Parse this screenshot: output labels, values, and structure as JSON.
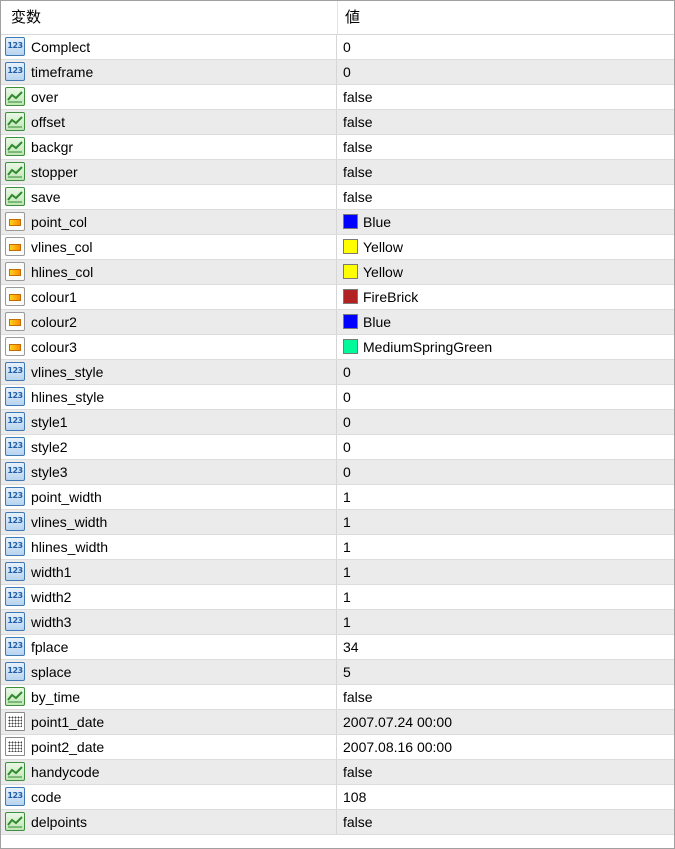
{
  "header": {
    "name_col": "変数",
    "value_col": "値"
  },
  "rows": [
    {
      "type": "int",
      "name": "Complect",
      "value": "0"
    },
    {
      "type": "int",
      "name": "timeframe",
      "value": "0"
    },
    {
      "type": "bool",
      "name": "over",
      "value": "false"
    },
    {
      "type": "bool",
      "name": "offset",
      "value": "false"
    },
    {
      "type": "bool",
      "name": "backgr",
      "value": "false"
    },
    {
      "type": "bool",
      "name": "stopper",
      "value": "false"
    },
    {
      "type": "bool",
      "name": "save",
      "value": "false"
    },
    {
      "type": "color",
      "name": "point_col",
      "value": "Blue",
      "swatch": "#0000ff"
    },
    {
      "type": "color",
      "name": "vlines_col",
      "value": "Yellow",
      "swatch": "#ffff00"
    },
    {
      "type": "color",
      "name": "hlines_col",
      "value": "Yellow",
      "swatch": "#ffff00"
    },
    {
      "type": "color",
      "name": "colour1",
      "value": "FireBrick",
      "swatch": "#b22222"
    },
    {
      "type": "color",
      "name": "colour2",
      "value": "Blue",
      "swatch": "#0000ff"
    },
    {
      "type": "color",
      "name": "colour3",
      "value": "MediumSpringGreen",
      "swatch": "#00fa9a"
    },
    {
      "type": "int",
      "name": "vlines_style",
      "value": "0"
    },
    {
      "type": "int",
      "name": "hlines_style",
      "value": "0"
    },
    {
      "type": "int",
      "name": "style1",
      "value": "0"
    },
    {
      "type": "int",
      "name": "style2",
      "value": "0"
    },
    {
      "type": "int",
      "name": "style3",
      "value": "0"
    },
    {
      "type": "int",
      "name": "point_width",
      "value": "1"
    },
    {
      "type": "int",
      "name": "vlines_width",
      "value": "1"
    },
    {
      "type": "int",
      "name": "hlines_width",
      "value": "1"
    },
    {
      "type": "int",
      "name": "width1",
      "value": "1"
    },
    {
      "type": "int",
      "name": "width2",
      "value": "1"
    },
    {
      "type": "int",
      "name": "width3",
      "value": "1"
    },
    {
      "type": "int",
      "name": "fplace",
      "value": "34"
    },
    {
      "type": "int",
      "name": "splace",
      "value": "5"
    },
    {
      "type": "bool",
      "name": "by_time",
      "value": "false"
    },
    {
      "type": "datetime",
      "name": "point1_date",
      "value": "2007.07.24 00:00"
    },
    {
      "type": "datetime",
      "name": "point2_date",
      "value": "2007.08.16 00:00"
    },
    {
      "type": "bool",
      "name": "handycode",
      "value": "false"
    },
    {
      "type": "int",
      "name": "code",
      "value": "108"
    },
    {
      "type": "bool",
      "name": "delpoints",
      "value": "false"
    }
  ],
  "icons": {
    "int": "integer-type-icon",
    "bool": "boolean-type-icon",
    "color": "color-type-icon",
    "datetime": "datetime-type-icon"
  },
  "int_icon_glyph": "123"
}
